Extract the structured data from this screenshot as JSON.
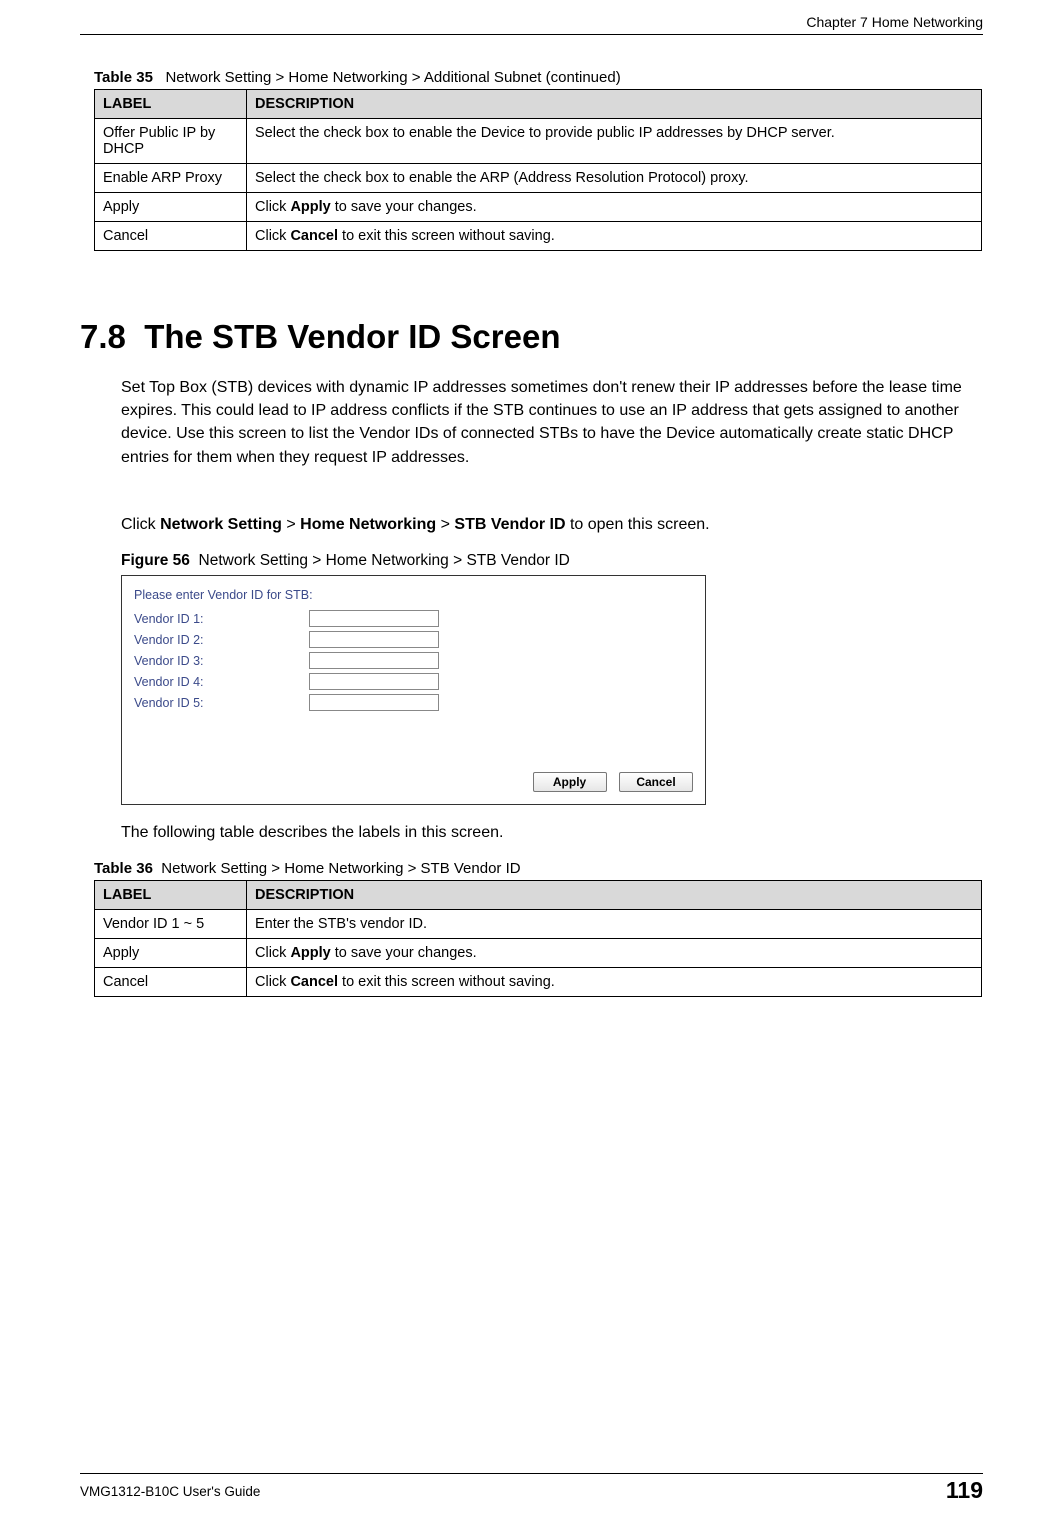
{
  "header": {
    "chapter": "Chapter 7 Home Networking"
  },
  "table35": {
    "caption_label": "Table 35",
    "caption_text": "Network Setting > Home Networking > Additional Subnet (continued)",
    "col_label": "LABEL",
    "col_desc": "DESCRIPTION",
    "rows": [
      {
        "label": "Offer Public IP by DHCP",
        "desc": "Select the check box to enable the Device to provide public IP addresses by DHCP server."
      },
      {
        "label": "Enable ARP Proxy",
        "desc": "Select the check box to enable the ARP (Address Resolution Protocol) proxy."
      },
      {
        "label": "Apply",
        "desc_prefix": "Click ",
        "desc_bold": "Apply",
        "desc_suffix": " to save your changes."
      },
      {
        "label": "Cancel",
        "desc_prefix": "Click ",
        "desc_bold": "Cancel",
        "desc_suffix": " to exit this screen without saving."
      }
    ]
  },
  "section": {
    "number": "7.8",
    "title": "The STB Vendor ID Screen",
    "para1": "Set Top Box (STB) devices with dynamic IP addresses sometimes don't renew their IP addresses before the lease time expires. This could lead to IP address conflicts if the STB continues to use an IP address that gets assigned to another device. Use this screen to list the Vendor IDs of connected STBs to have the Device automatically create static DHCP entries for them when they request IP addresses.",
    "para2_prefix": "Click ",
    "para2_path1": "Network Setting",
    "para2_sep1": " > ",
    "para2_path2": "Home Networking",
    "para2_sep2": " > ",
    "para2_path3": "STB Vendor ID",
    "para2_suffix": " to open this screen."
  },
  "figure56": {
    "caption_label": "Figure 56",
    "caption_text": "Network Setting > Home Networking > STB Vendor ID",
    "prompt": "Please enter Vendor ID for STB:",
    "fields": [
      {
        "label": "Vendor ID 1:",
        "value": ""
      },
      {
        "label": "Vendor ID 2:",
        "value": ""
      },
      {
        "label": "Vendor ID 3:",
        "value": ""
      },
      {
        "label": "Vendor ID 4:",
        "value": ""
      },
      {
        "label": "Vendor ID 5:",
        "value": ""
      }
    ],
    "apply_btn": "Apply",
    "cancel_btn": "Cancel"
  },
  "para3": "The following table describes the labels in this screen.",
  "table36": {
    "caption_label": "Table 36",
    "caption_text": "Network Setting > Home Networking > STB Vendor ID",
    "col_label": "LABEL",
    "col_desc": "DESCRIPTION",
    "rows": [
      {
        "label": "Vendor ID 1 ~ 5",
        "desc": "Enter the STB's vendor ID."
      },
      {
        "label": "Apply",
        "desc_prefix": "Click ",
        "desc_bold": "Apply",
        "desc_suffix": " to save your changes."
      },
      {
        "label": "Cancel",
        "desc_prefix": "Click ",
        "desc_bold": "Cancel",
        "desc_suffix": " to exit this screen without saving."
      }
    ]
  },
  "footer": {
    "guide": "VMG1312-B10C User's Guide",
    "page": "119"
  }
}
